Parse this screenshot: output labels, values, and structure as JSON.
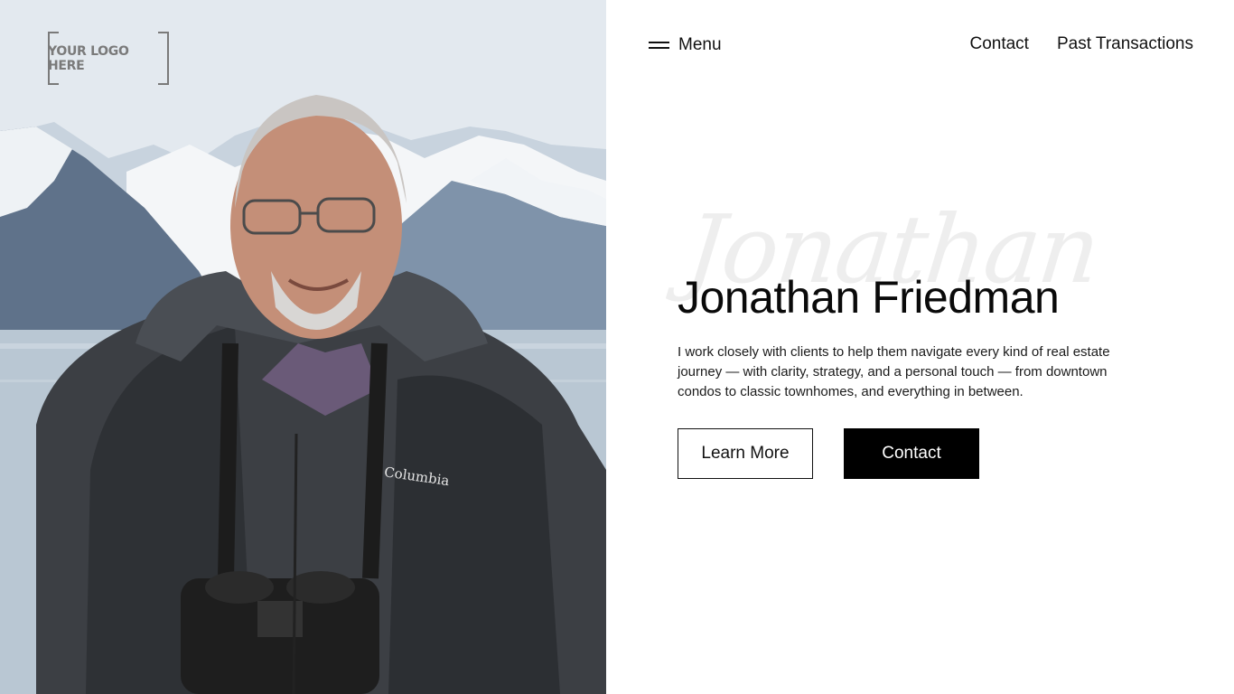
{
  "logo": {
    "text": "YOUR LOGO HERE"
  },
  "nav": {
    "menu_label": "Menu",
    "links": [
      {
        "label": "Contact"
      },
      {
        "label": "Past Transactions"
      }
    ]
  },
  "hero": {
    "script_word": "Jonathan",
    "title": "Jonathan Friedman",
    "description": "I work closely with clients to help them navigate every kind of real estate journey — with clarity, strategy, and a personal touch — from downtown condos to classic townhomes, and everything in between.",
    "primary_button": "Learn More",
    "secondary_button": "Contact"
  },
  "photo": {
    "jacket_brand": "Columbia"
  },
  "colors": {
    "primary": "#000000",
    "background": "#ffffff",
    "text": "#111111"
  }
}
